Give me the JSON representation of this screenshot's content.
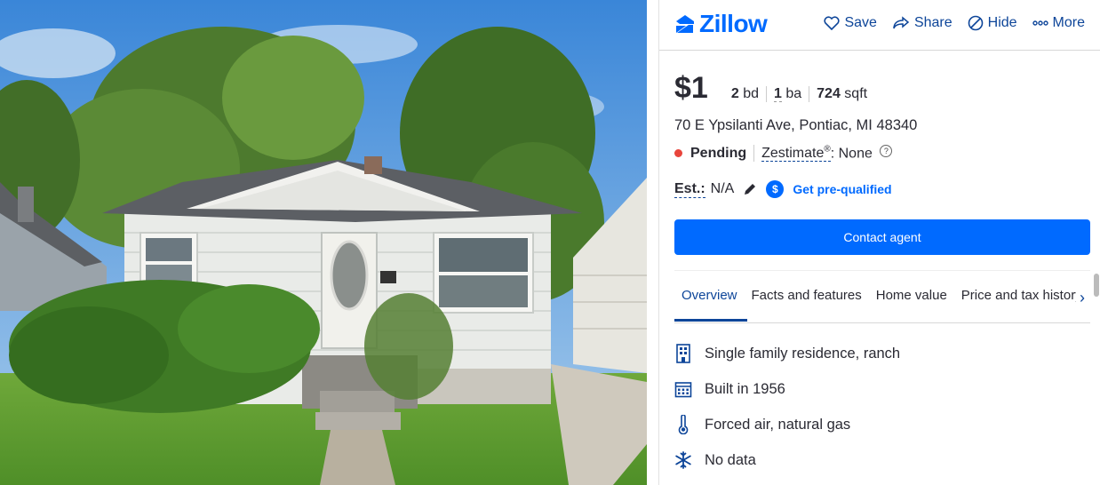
{
  "brand": {
    "name": "Zillow",
    "color": "#006aff"
  },
  "actions": [
    {
      "label": "Save",
      "icon": "heart-icon"
    },
    {
      "label": "Share",
      "icon": "share-icon"
    },
    {
      "label": "Hide",
      "icon": "hide-icon"
    },
    {
      "label": "More",
      "icon": "more-icon"
    }
  ],
  "listing": {
    "price": "$1",
    "beds_value": "2",
    "beds_unit": "bd",
    "baths_value": "1",
    "baths_unit": "ba",
    "sqft_value": "724",
    "sqft_unit": "sqft",
    "address": "70 E Ypsilanti Ave, Pontiac, MI 48340",
    "status": "Pending",
    "status_color": "#e8453c",
    "zestimate_label": "Zestimate",
    "zestimate_reg": "®",
    "zestimate_value": ": None",
    "help_mark": "?",
    "est_label": "Est.:",
    "est_value": "N/A",
    "prequal_icon_text": "$",
    "prequal_label": "Get pre-qualified"
  },
  "contact_button": "Contact agent",
  "tabs": [
    {
      "label": "Overview",
      "active": true
    },
    {
      "label": "Facts and features"
    },
    {
      "label": "Home value"
    },
    {
      "label": "Price and tax history"
    }
  ],
  "facts": [
    {
      "icon": "building-icon",
      "text": "Single family residence, ranch"
    },
    {
      "icon": "calendar-icon",
      "text": "Built in 1956"
    },
    {
      "icon": "thermometer-icon",
      "text": "Forced air, natural gas"
    },
    {
      "icon": "snowflake-icon",
      "text": "No data"
    }
  ]
}
